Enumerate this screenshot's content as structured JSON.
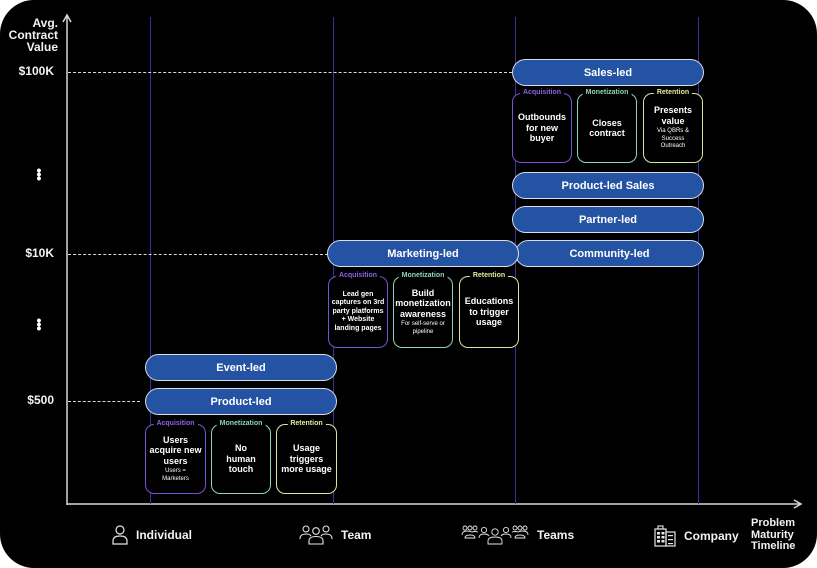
{
  "y_axis": {
    "title": "Avg. Contract Value",
    "title_lines": [
      "Avg.",
      "Contract",
      "Value"
    ],
    "ticks": [
      {
        "label": "$100K",
        "level": "high"
      },
      {
        "label": "⋮",
        "level": "gap-upper"
      },
      {
        "label": "$10K",
        "level": "mid"
      },
      {
        "label": "⋮",
        "level": "gap-lower"
      },
      {
        "label": "$500",
        "level": "low"
      }
    ]
  },
  "x_axis": {
    "title": "Problem Maturity Timeline",
    "title_lines": [
      "Problem",
      "Maturity",
      "Timeline"
    ],
    "stages": [
      {
        "label": "Individual",
        "icon": "person-icon"
      },
      {
        "label": "Team",
        "icon": "group-icon"
      },
      {
        "label": "Teams",
        "icon": "crowd-icon"
      },
      {
        "label": "Company",
        "icon": "building-icon"
      }
    ]
  },
  "tiers": [
    {
      "level": "$500",
      "stage": "Individual",
      "motions": [
        "Event-led",
        "Product-led"
      ],
      "cards": [
        {
          "type": "Acquisition",
          "main": "Users acquire new users",
          "sub": "Users = Marketers"
        },
        {
          "type": "Monetization",
          "main": "No human touch",
          "sub": ""
        },
        {
          "type": "Retention",
          "main": "Usage triggers more usage",
          "sub": ""
        }
      ]
    },
    {
      "level": "$10K",
      "stage": "Team",
      "motions": [
        "Marketing-led"
      ],
      "cards": [
        {
          "type": "Acquisition",
          "main": "Lead gen captures on 3rd party platforms + Website landing pages",
          "sub": ""
        },
        {
          "type": "Monetization",
          "main": "Build monetization awareness",
          "sub": "For self-serve or pipeline"
        },
        {
          "type": "Retention",
          "main": "Educations to trigger usage",
          "sub": ""
        }
      ]
    },
    {
      "level": "$100K",
      "stage": "Teams",
      "motions": [
        "Sales-led",
        "Product-led Sales",
        "Partner-led",
        "Community-led"
      ],
      "cards": [
        {
          "type": "Acquisition",
          "main": "Outbounds for new buyer",
          "sub": ""
        },
        {
          "type": "Monetization",
          "main": "Closes contract",
          "sub": ""
        },
        {
          "type": "Retention",
          "main": "Presents value",
          "sub": "Via QBRs & Success Outreach"
        }
      ]
    }
  ],
  "colors": {
    "background": "#000000",
    "pill_fill": "#2453a3",
    "acquisition": "#8a63e6",
    "monetization": "#8ed6b7",
    "retention": "#e4eb9c",
    "column_line": "#3a2f9e"
  }
}
